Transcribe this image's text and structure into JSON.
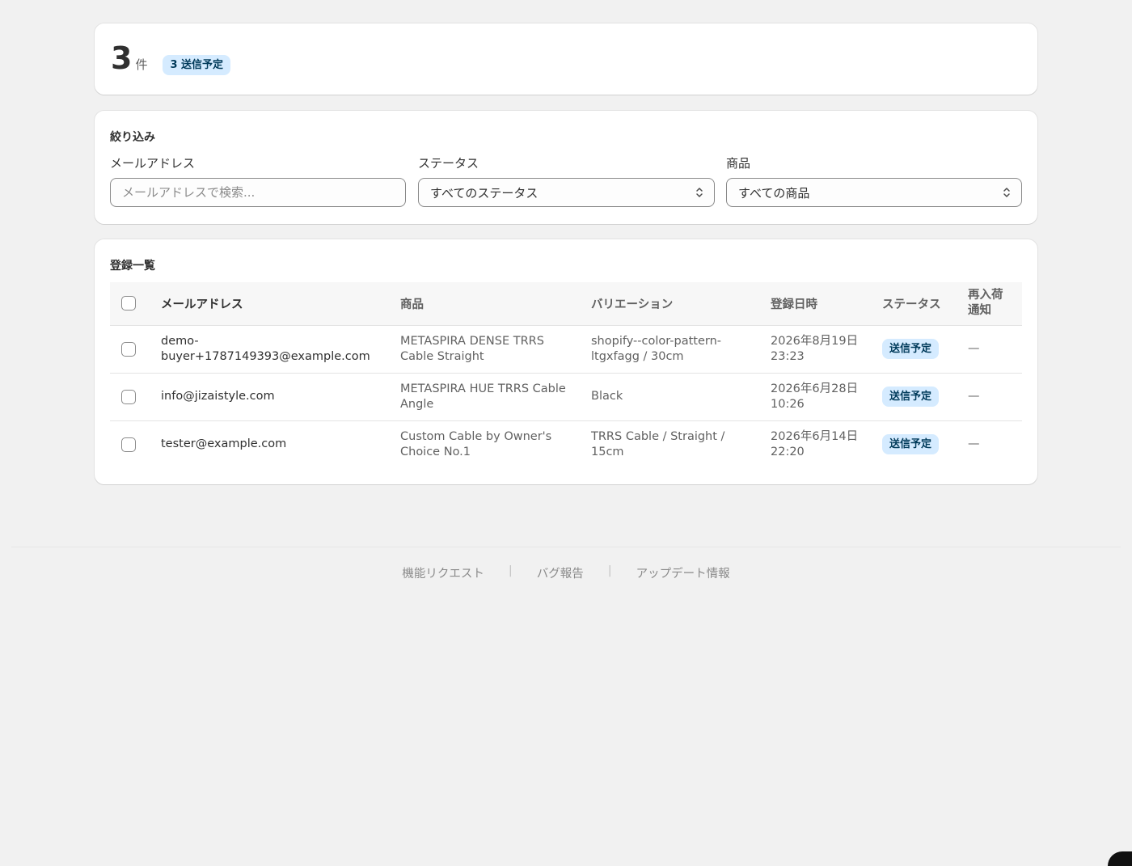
{
  "summary": {
    "count": "3",
    "unit": "件",
    "badge": "3 送信予定"
  },
  "filters": {
    "title": "絞り込み",
    "email": {
      "label": "メールアドレス",
      "placeholder": "メールアドレスで検索..."
    },
    "status": {
      "label": "ステータス",
      "value": "すべてのステータス"
    },
    "product": {
      "label": "商品",
      "value": "すべての商品"
    }
  },
  "list": {
    "title": "登録一覧",
    "columns": {
      "email": "メールアドレス",
      "product": "商品",
      "variant": "バリエーション",
      "date": "登録日時",
      "status": "ステータス",
      "restock": "再入荷\n通知"
    },
    "rows": [
      {
        "email_line1": "demo-",
        "email_line2": "buyer+1787149393@example.com",
        "product_line1": "METASPIRA DENSE TRRS",
        "product_line2": "Cable Straight",
        "variant_line1": "shopify--color-pattern-",
        "variant_line2": "ltgxfagg / 30cm",
        "date_line1": "2026年8月19日",
        "date_line2": "23:23",
        "status": "送信予定",
        "restock": "—"
      },
      {
        "email_line1": "info@jizaistyle.com",
        "email_line2": "",
        "product_line1": "METASPIRA HUE TRRS Cable",
        "product_line2": "Angle",
        "variant_line1": "Black",
        "variant_line2": "",
        "date_line1": "2026年6月28日",
        "date_line2": "10:26",
        "status": "送信予定",
        "restock": "—"
      },
      {
        "email_line1": "tester@example.com",
        "email_line2": "",
        "product_line1": "Custom Cable by Owner's",
        "product_line2": "Choice No.1",
        "variant_line1": "TRRS Cable / Straight /",
        "variant_line2": "15cm",
        "date_line1": "2026年6月14日",
        "date_line2": "22:20",
        "status": "送信予定",
        "restock": "—"
      }
    ]
  },
  "footer": {
    "feature_request": "機能リクエスト",
    "bug_report": "バグ報告",
    "updates": "アップデート情報",
    "separator": "|"
  },
  "colors": {
    "background": "#f1f1f1",
    "card": "#ffffff",
    "badge_bg": "#d5ebff",
    "badge_text": "#003a5a"
  }
}
